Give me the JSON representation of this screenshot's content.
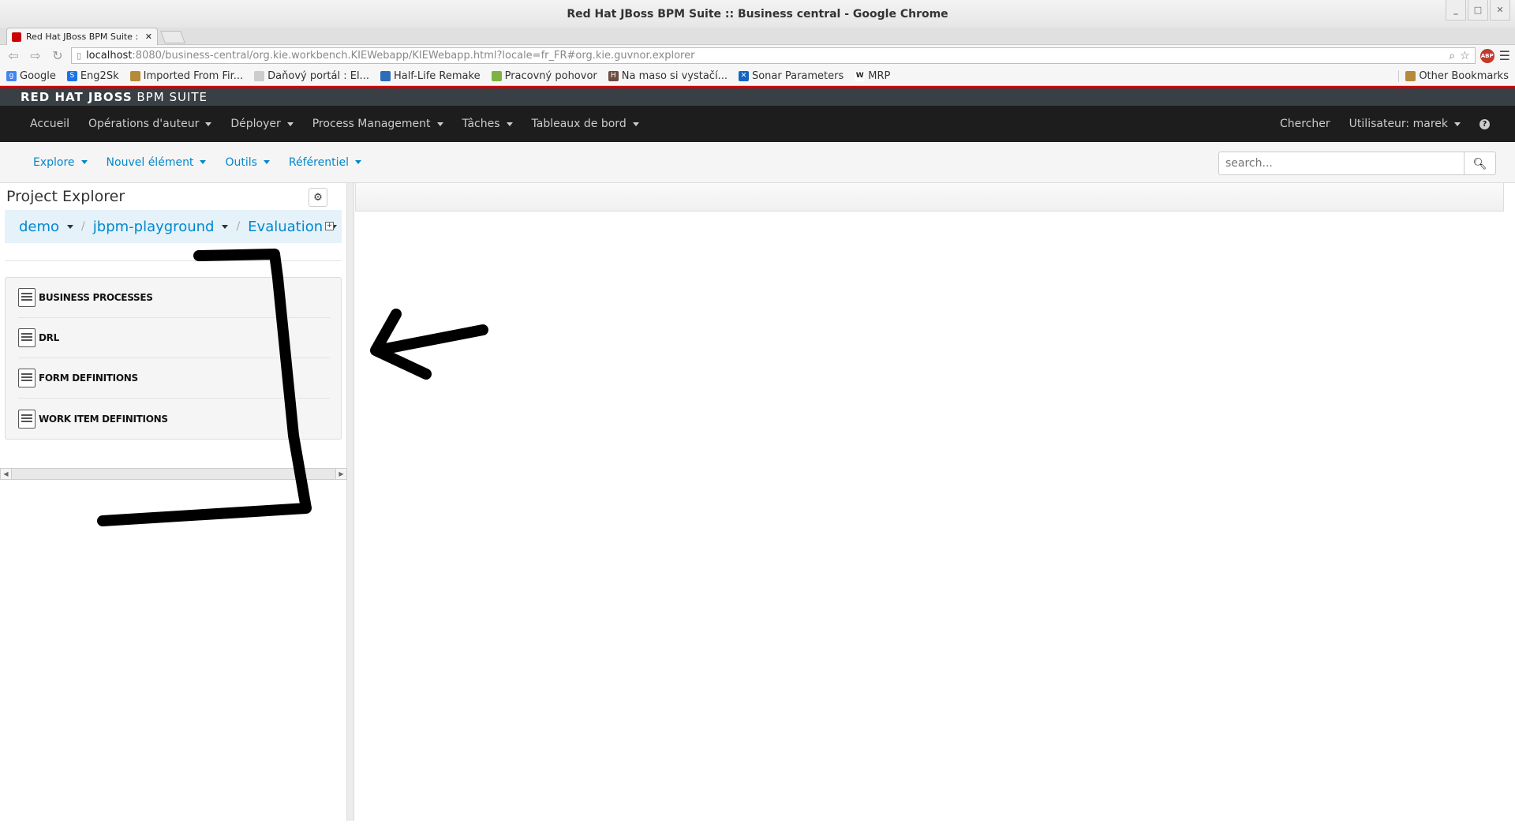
{
  "window": {
    "title": "Red Hat JBoss BPM Suite :: Business central - Google Chrome",
    "controls": [
      "_",
      "□",
      "✕"
    ]
  },
  "tab": {
    "title": "Red Hat JBoss BPM Suite :",
    "close": "✕"
  },
  "address": {
    "host": "localhost",
    "path": ":8080/business-central/org.kie.workbench.KIEWebapp/KIEWebapp.html?locale=fr_FR#org.kie.guvnor.explorer"
  },
  "bookmarks": [
    {
      "label": "Google",
      "color": "#4285f4",
      "glyph": "g"
    },
    {
      "label": "Eng2Sk",
      "color": "#1a73e8",
      "glyph": "S"
    },
    {
      "label": "Imported From Fir...",
      "color": "#b58b3a",
      "glyph": ""
    },
    {
      "label": "Daňový portál : El...",
      "color": "#cccccc",
      "glyph": ""
    },
    {
      "label": "Half-Life Remake",
      "color": "#2a6ebb",
      "glyph": ""
    },
    {
      "label": "Pracovný pohovor",
      "color": "#7cb342",
      "glyph": ""
    },
    {
      "label": "Na maso si vystačí...",
      "color": "#6d4c41",
      "glyph": "H"
    },
    {
      "label": "Sonar Parameters",
      "color": "#1565c0",
      "glyph": "✕"
    },
    {
      "label": "MRP",
      "color": "#ffffff",
      "glyph": "W"
    }
  ],
  "other_bookmarks": "Other Bookmarks",
  "brand": {
    "bold": "RED HAT JBOSS",
    "rest": " BPM SUITE"
  },
  "main_nav": [
    {
      "label": "Accueil",
      "dropdown": false
    },
    {
      "label": "Opérations d'auteur",
      "dropdown": true
    },
    {
      "label": "Déployer",
      "dropdown": true
    },
    {
      "label": "Process Management",
      "dropdown": true
    },
    {
      "label": "Tâches",
      "dropdown": true
    },
    {
      "label": "Tableaux de bord",
      "dropdown": true
    }
  ],
  "main_nav_right": {
    "search": "Chercher",
    "user": "Utilisateur: marek",
    "help": "?"
  },
  "sub_nav": [
    "Explore",
    "Nouvel élément",
    "Outils",
    "Référentiel"
  ],
  "search": {
    "placeholder": "search..."
  },
  "project_explorer": {
    "title": "Project Explorer",
    "breadcrumbs": [
      "demo",
      "jbpm-playground",
      "Evaluation"
    ],
    "folders": [
      "BUSINESS PROCESSES",
      "DRL",
      "FORM DEFINITIONS",
      "WORK ITEM DEFINITIONS"
    ]
  },
  "colors": {
    "accent": "#0088ce",
    "brand_red": "#cc0000",
    "nav_bg": "#1d1d1d"
  }
}
